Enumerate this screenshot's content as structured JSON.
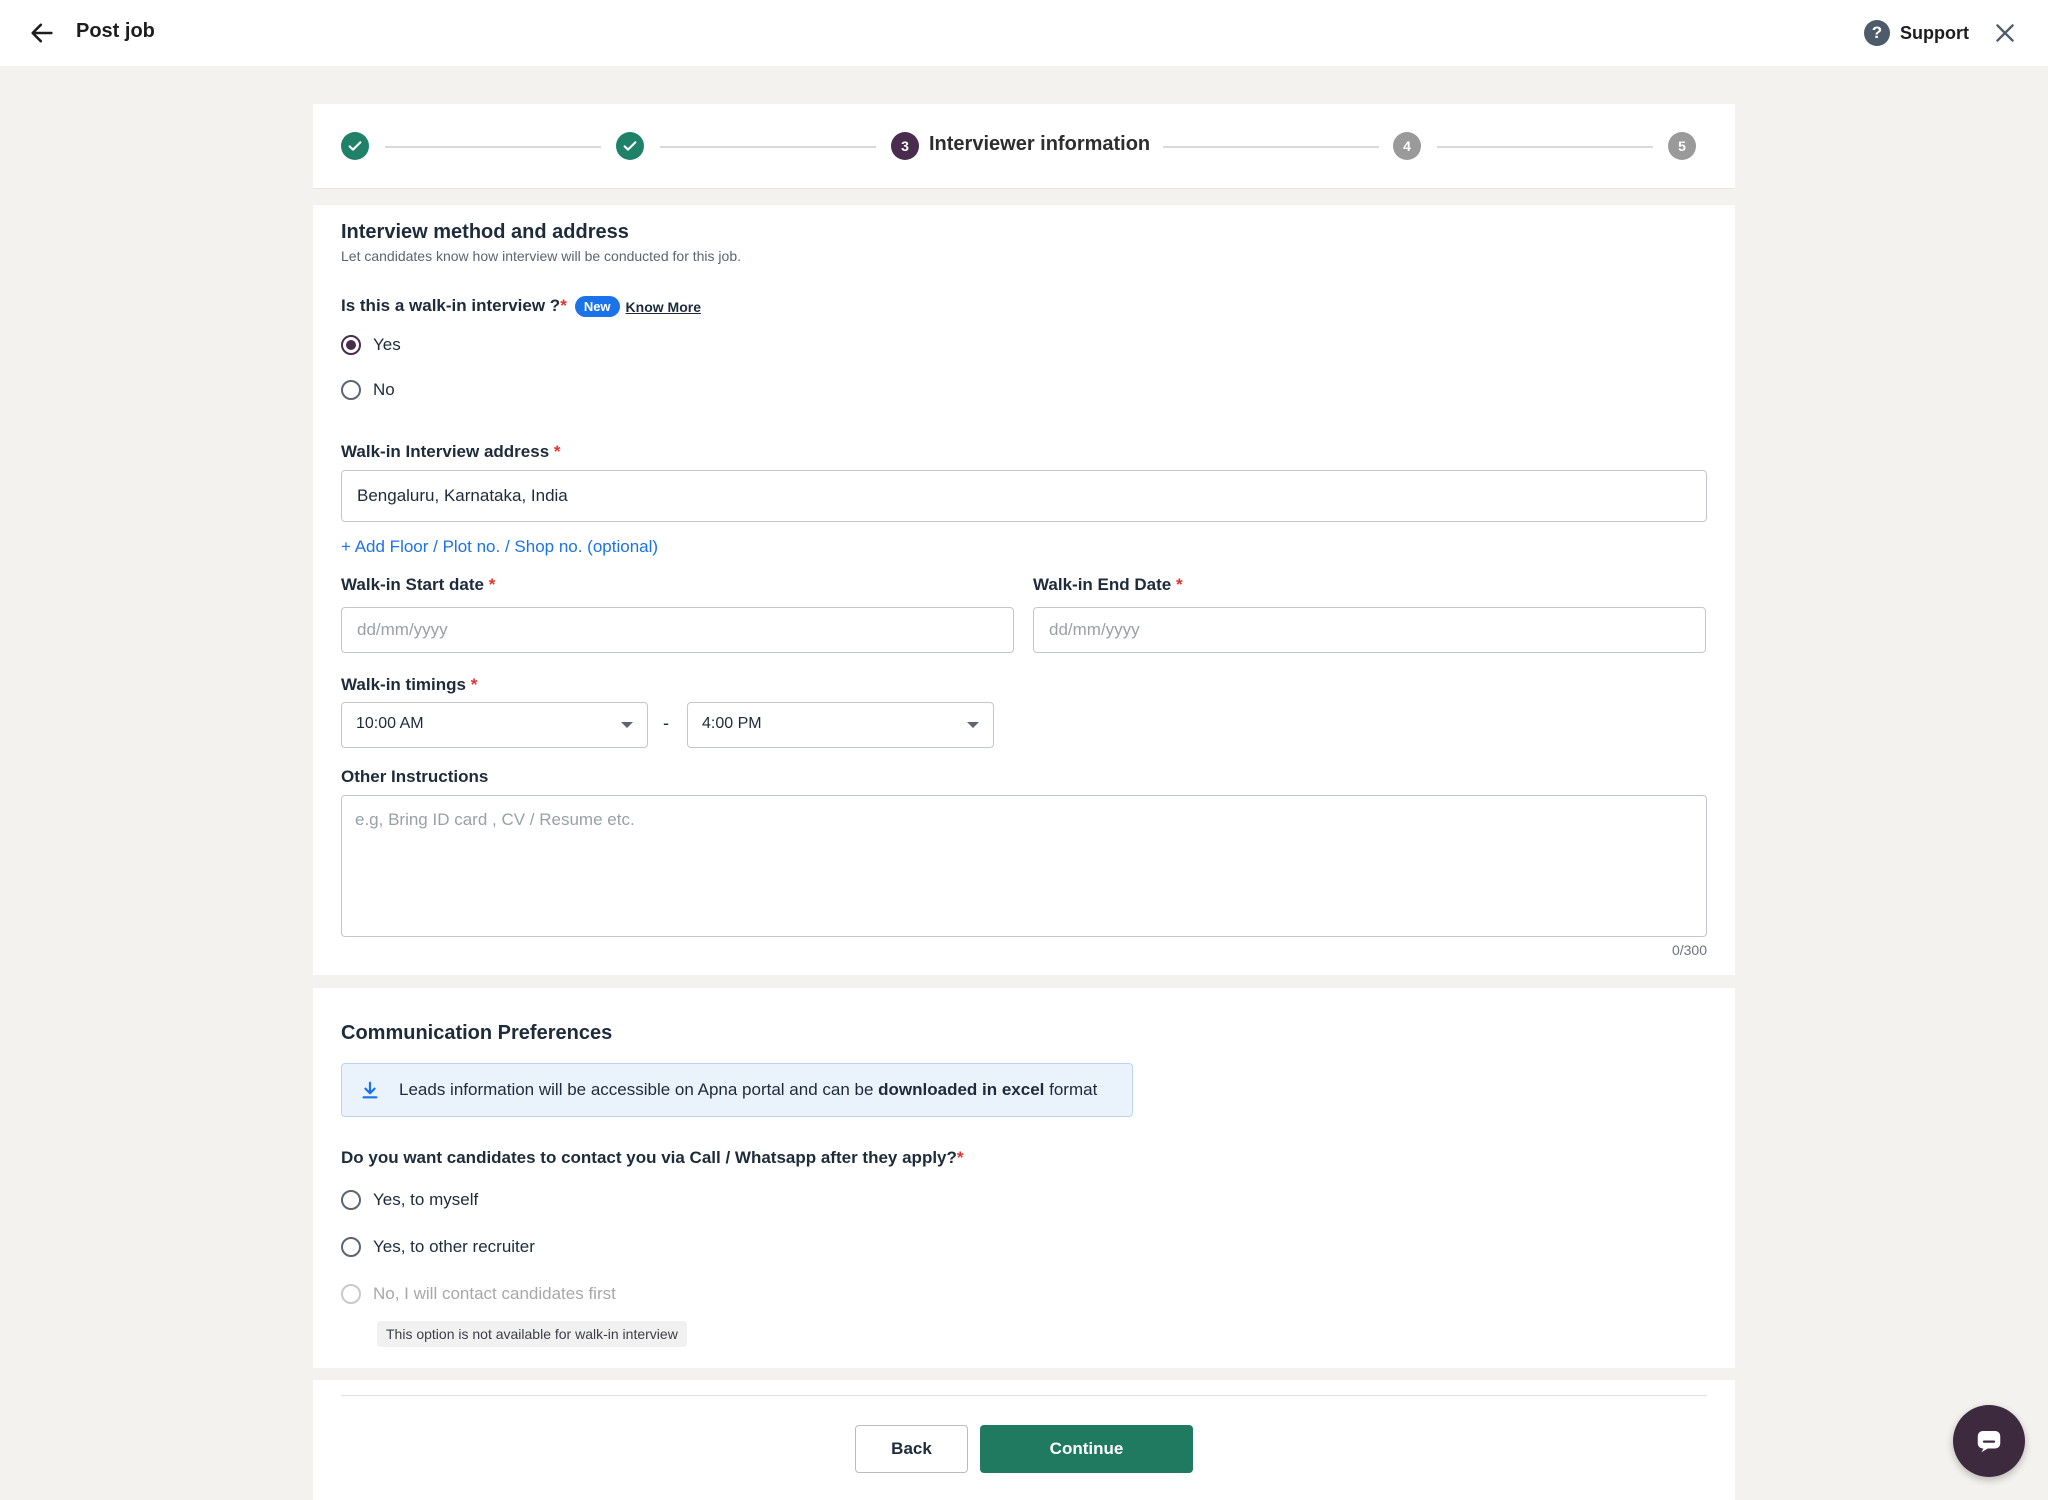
{
  "header": {
    "title": "Post job",
    "support_label": "Support"
  },
  "stepper": {
    "steps": [
      {
        "state": "done"
      },
      {
        "state": "done"
      },
      {
        "number": "3",
        "label": "Interviewer information",
        "state": "current"
      },
      {
        "number": "4",
        "state": "todo"
      },
      {
        "number": "5",
        "state": "todo"
      }
    ]
  },
  "interview": {
    "title": "Interview method and address",
    "subtitle": "Let candidates know how interview will be conducted for this job.",
    "walkin_question": "Is this a walk-in interview ?",
    "required_mark": "*",
    "new_badge": "New",
    "know_more": "Know More",
    "options": [
      {
        "label": "Yes",
        "selected": true
      },
      {
        "label": "No",
        "selected": false
      }
    ],
    "address_label": "Walk-in Interview address",
    "address_value": "Bengaluru, Karnataka, India",
    "add_floor_link": "+ Add Floor / Plot no. / Shop no. (optional)",
    "start_date_label": "Walk-in Start date",
    "start_date_placeholder": "dd/mm/yyyy",
    "end_date_label": "Walk-in End Date",
    "end_date_placeholder": "dd/mm/yyyy",
    "timings_label": "Walk-in timings",
    "time_from": "10:00 AM",
    "time_separator": "-",
    "time_to": "4:00 PM",
    "instructions_label": "Other Instructions",
    "instructions_placeholder": "e.g, Bring ID card , CV / Resume etc.",
    "instructions_counter": "0/300"
  },
  "communication": {
    "title": "Communication Preferences",
    "banner_text_start": "Leads information will be accessible on Apna portal and can be ",
    "banner_text_bold": "downloaded in excel",
    "banner_text_end": " format",
    "question": "Do you want candidates to contact you via Call / Whatsapp after they apply?",
    "options": [
      {
        "label": "Yes, to myself",
        "disabled": false
      },
      {
        "label": "Yes, to other recruiter",
        "disabled": false
      },
      {
        "label": "No, I will contact candidates first",
        "disabled": true
      }
    ],
    "disabled_note": "This option is not available for walk-in interview"
  },
  "footer": {
    "back_label": "Back",
    "continue_label": "Continue"
  },
  "colors": {
    "primary": "#1f7a5f",
    "accent_purple": "#4a2d4e",
    "link_blue": "#1a73e8"
  }
}
